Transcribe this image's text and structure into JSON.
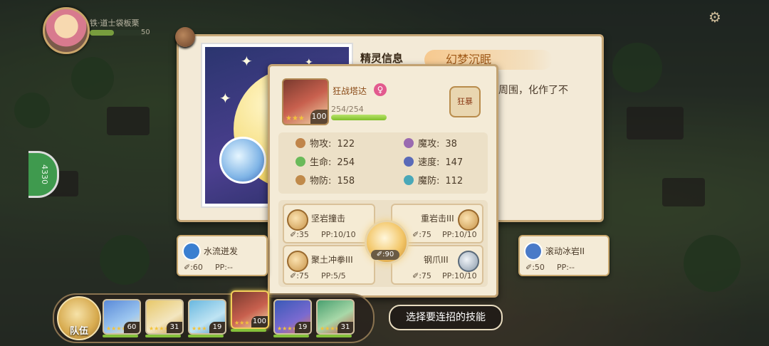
{
  "player": {
    "name": "铁·道士袋板栗",
    "level": "50",
    "settings_icon": "gear-icon"
  },
  "side_button": {
    "label": "4330"
  },
  "book": {
    "tab_label": "精灵信息",
    "title": "幻梦沉眠",
    "description": "周围，化作了不"
  },
  "pet": {
    "name": "狂战塔达",
    "gender": "♀",
    "gender_icon": "female-icon",
    "level": "100",
    "stars": "★★★",
    "hp": "254/254",
    "hp_fraction": 1.0,
    "nature": "狂暴"
  },
  "stats": [
    {
      "label": "物攻:",
      "value": "122",
      "icon": "physical-attack-icon",
      "color": "#c0854a"
    },
    {
      "label": "魔攻:",
      "value": "38",
      "icon": "magic-attack-icon",
      "color": "#9a6ab0"
    },
    {
      "label": "生命:",
      "value": "254",
      "icon": "health-icon",
      "color": "#6aba5a"
    },
    {
      "label": "速度:",
      "value": "147",
      "icon": "speed-icon",
      "color": "#5a6ab8"
    },
    {
      "label": "物防:",
      "value": "158",
      "icon": "physical-defense-icon",
      "color": "#c08a4a"
    },
    {
      "label": "魔防:",
      "value": "112",
      "icon": "magic-defense-icon",
      "color": "#4aa8b8"
    }
  ],
  "skills": [
    {
      "name": "坚岩撞击",
      "power": "✐:35",
      "pp": "PP:10/10",
      "icon": "rock-skill-icon"
    },
    {
      "name": "重岩击III",
      "power": "✐:75",
      "pp": "PP:10/10",
      "icon": "rock-skill-icon"
    },
    {
      "name": "聚土冲拳III",
      "power": "✐:75",
      "pp": "PP:5/5",
      "icon": "rock-skill-icon"
    },
    {
      "name": "钢爪III",
      "power": "✐:75",
      "pp": "PP:10/10",
      "icon": "steel-skill-icon"
    }
  ],
  "combo": {
    "power": "90"
  },
  "side_skills": {
    "left": {
      "name": "水流迸发",
      "power": "✐:60",
      "pp": "PP:--",
      "icon": "water-skill-icon",
      "color": "#3a7fd0"
    },
    "right": {
      "name": "滚动冰岩II",
      "power": "✐:50",
      "pp": "PP:--",
      "icon": "ice-skill-icon",
      "color": "#4a7ac8"
    }
  },
  "team": {
    "label": "队伍",
    "slots": [
      {
        "level": "60",
        "stars": "★★★★★",
        "active": false
      },
      {
        "level": "31",
        "stars": "★★★★★",
        "active": false
      },
      {
        "level": "19",
        "stars": "★★★",
        "active": false
      },
      {
        "level": "100",
        "stars": "★★★",
        "active": true
      },
      {
        "level": "19",
        "stars": "★★★★★",
        "active": false
      },
      {
        "level": "31",
        "stars": "★★★★",
        "active": false
      }
    ]
  },
  "prompt": {
    "label": "选择要连招的技能"
  }
}
